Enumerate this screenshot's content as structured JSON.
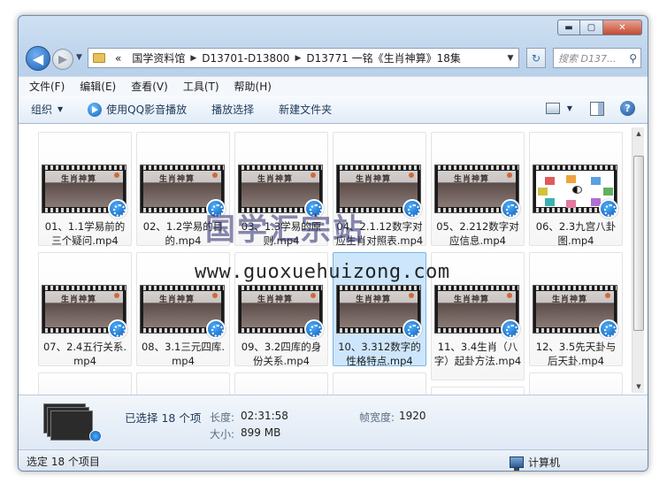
{
  "window": {
    "buttons": {
      "minimize": "▬",
      "maximize": "▢",
      "close": "✕"
    }
  },
  "nav": {
    "back_glyph": "◀",
    "forward_glyph": "▶",
    "history_caret": "▼",
    "address": {
      "overflow": "«",
      "crumbs": [
        "国学资料馆",
        "D13701-D13800",
        "D13771 一铭《生肖神算》18集"
      ],
      "separator": "▶",
      "dropdown": "▼"
    },
    "refresh_glyph": "↻",
    "search_placeholder": "搜索 D137...",
    "search_glyph": "⚲"
  },
  "menubar": [
    "文件(F)",
    "编辑(E)",
    "查看(V)",
    "工具(T)",
    "帮助(H)"
  ],
  "toolbar": {
    "organize": "组织",
    "caret": "▼",
    "play_qq": "使用QQ影音播放",
    "play_select": "播放选择",
    "new_folder": "新建文件夹",
    "view_caret": "▼",
    "help": "?"
  },
  "thumb_text": "生肖神算",
  "files": [
    {
      "label": "01、1.1学易前的三个疑问.mp4",
      "thumb": "chart-alt",
      "selected": false
    },
    {
      "label": "02、1.2学易的目的.mp4",
      "thumb": "video",
      "selected": false
    },
    {
      "label": "03、1.3学易的原则.mp4",
      "thumb": "video",
      "selected": false
    },
    {
      "label": "04、2.1.12数字对应生肖对照表.mp4",
      "thumb": "video",
      "selected": false
    },
    {
      "label": "05、2.212数字对应信息.mp4",
      "thumb": "video",
      "selected": false
    },
    {
      "label": "06、2.3九宫八卦图.mp4",
      "thumb": "chart",
      "selected": false
    },
    {
      "label": "07、2.4五行关系.mp4",
      "thumb": "video",
      "selected": false
    },
    {
      "label": "08、3.1三元四库.mp4",
      "thumb": "video",
      "selected": false
    },
    {
      "label": "09、3.2四库的身份关系.mp4",
      "thumb": "video",
      "selected": false
    },
    {
      "label": "10、3.312数字的性格特点.mp4",
      "thumb": "video",
      "selected": true
    },
    {
      "label": "11、3.4生肖（八字）起卦方法.mp4",
      "thumb": "video",
      "selected": false
    },
    {
      "label": "12、3.5先天卦与后天卦.mp4",
      "thumb": "video",
      "selected": false
    }
  ],
  "watermark": {
    "cn": "国学汇宗站",
    "url": "www.guoxuehuizong.com"
  },
  "details": {
    "selected": "已选择 18 个项",
    "duration_label": "长度:",
    "duration_value": "02:31:58",
    "size_label": "大小:",
    "size_value": "899 MB",
    "width_label": "帧宽度:",
    "width_value": "1920"
  },
  "status": {
    "left": "选定 18 个项目",
    "right": "计算机"
  },
  "scroll": {
    "up": "▲",
    "down": "▼"
  }
}
